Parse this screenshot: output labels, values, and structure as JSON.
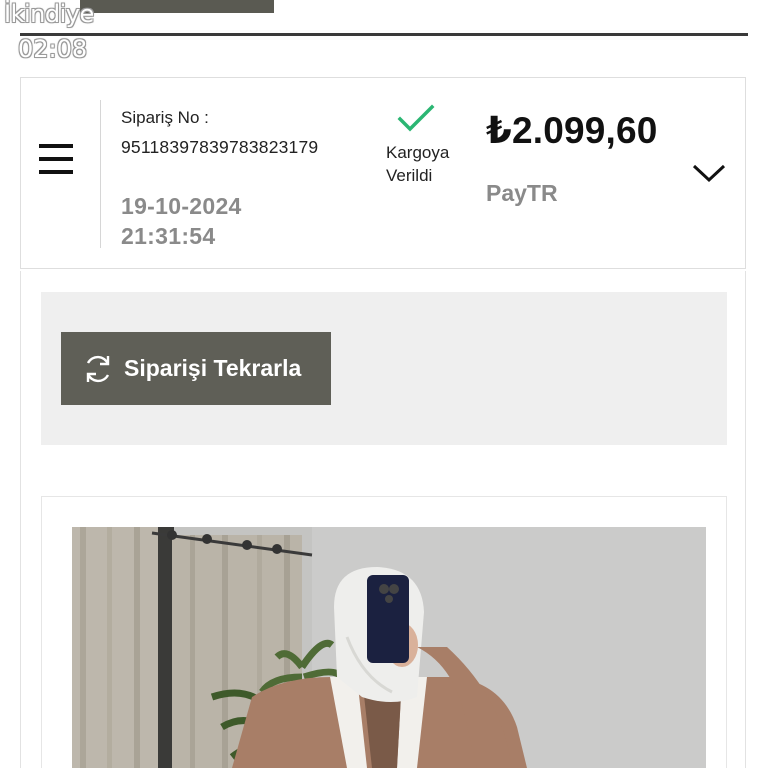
{
  "overlay": {
    "title": "İkindiye",
    "time": "02:08"
  },
  "order": {
    "number_label": "Sipariş No :",
    "number": "951183978397838231 79",
    "date": "19-10-2024",
    "time": "21:31:54",
    "status_line1": "Kargoya",
    "status_line2": "Verildi",
    "price": "₺2.099,60",
    "payment_method": "PayTR"
  },
  "actions": {
    "repeat_label": "Siparişi Tekrarla"
  },
  "icons": {
    "menu": "hamburger-menu-icon",
    "status": "checkmark-icon",
    "expand": "chevron-down-icon",
    "repeat": "refresh-icon"
  },
  "colors": {
    "check": "#2bb673",
    "button": "#5f5f57",
    "muted_text": "#8a8a8a"
  }
}
